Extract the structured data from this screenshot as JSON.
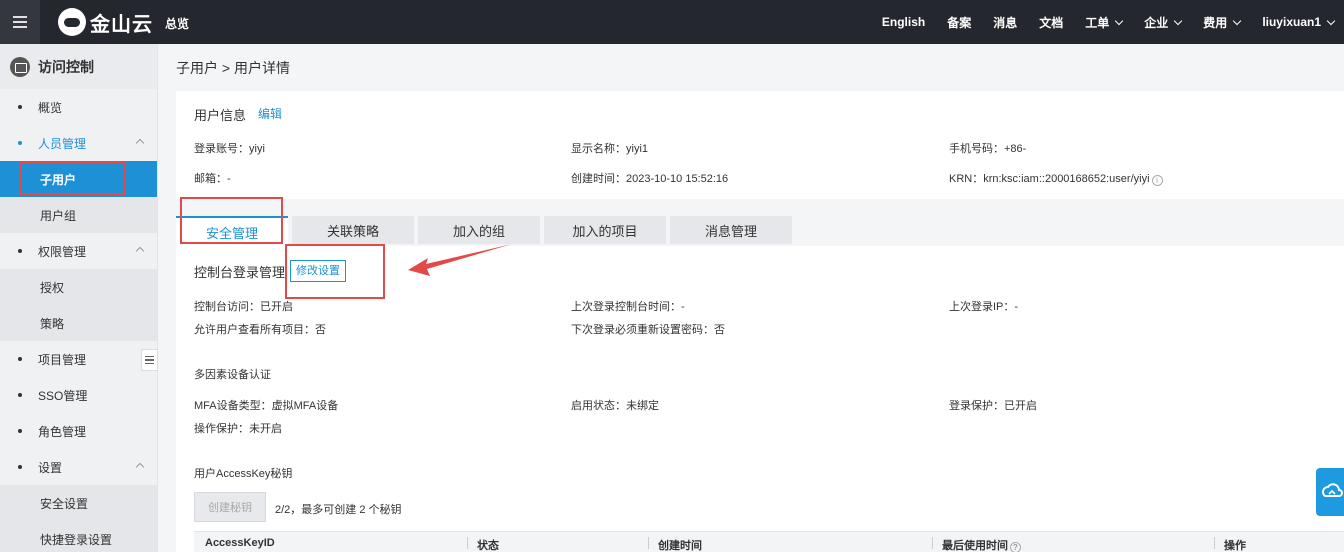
{
  "topbar": {
    "brand": "金山云",
    "overview": "总览",
    "nav": [
      {
        "label": "English",
        "dropdown": false
      },
      {
        "label": "备案",
        "dropdown": false
      },
      {
        "label": "消息",
        "dropdown": false
      },
      {
        "label": "文档",
        "dropdown": false
      },
      {
        "label": "工单",
        "dropdown": true
      },
      {
        "label": "企业",
        "dropdown": true
      },
      {
        "label": "费用",
        "dropdown": true
      },
      {
        "label": "liuyixuan1",
        "dropdown": true
      }
    ]
  },
  "sidebar": {
    "title": "访问控制",
    "items": [
      {
        "label": "概览"
      },
      {
        "label": "人员管理"
      },
      {
        "label": "子用户"
      },
      {
        "label": "用户组"
      },
      {
        "label": "权限管理"
      },
      {
        "label": "授权"
      },
      {
        "label": "策略"
      },
      {
        "label": "项目管理"
      },
      {
        "label": "SSO管理"
      },
      {
        "label": "角色管理"
      },
      {
        "label": "设置"
      },
      {
        "label": "安全设置"
      },
      {
        "label": "快捷登录设置"
      }
    ]
  },
  "breadcrumb": {
    "parent": "子用户",
    "separator": ">",
    "current": "用户详情"
  },
  "user_info": {
    "title": "用户信息",
    "edit_label": "编辑",
    "login_account": "登录账号：yiyi",
    "display_name": "显示名称：yiyi1",
    "phone": "手机号码：+86-",
    "email": "邮箱：-",
    "created_time": "创建时间：2023-10-10 15:52:16",
    "krn": "KRN：krn:ksc:iam::2000168652:user/yiyi"
  },
  "tabs": [
    {
      "label": "安全管理",
      "active": true
    },
    {
      "label": "关联策略",
      "active": false
    },
    {
      "label": "加入的组",
      "active": false
    },
    {
      "label": "加入的项目",
      "active": false
    },
    {
      "label": "消息管理",
      "active": false
    }
  ],
  "security": {
    "console_title": "控制台登录管理",
    "modify_label": "修改设置",
    "console_access": "控制台访问：已开启",
    "last_login_time": "上次登录控制台时间：-",
    "last_login_ip": "上次登录IP：-",
    "allow_view_projects": "允许用户查看所有项目：否",
    "reset_password_next_login": "下次登录必须重新设置密码：否",
    "mfa_title": "多因素设备认证",
    "mfa_type": "MFA设备类型：虚拟MFA设备",
    "mfa_status": "启用状态：未绑定",
    "login_protection": "登录保护：已开启",
    "operation_protection": "操作保护：未开启",
    "accesskey_title": "用户AccessKey秘钥",
    "create_key_label": "创建秘钥",
    "key_quota": "2/2，最多可创建 2 个秘钥",
    "table_headers": [
      "AccessKeyID",
      "状态",
      "创建时间",
      "最后使用时间",
      "操作"
    ]
  },
  "colors": {
    "topbar_bg": "#24272d",
    "accent": "#1e90d6",
    "highlight": "#e24a4a"
  }
}
